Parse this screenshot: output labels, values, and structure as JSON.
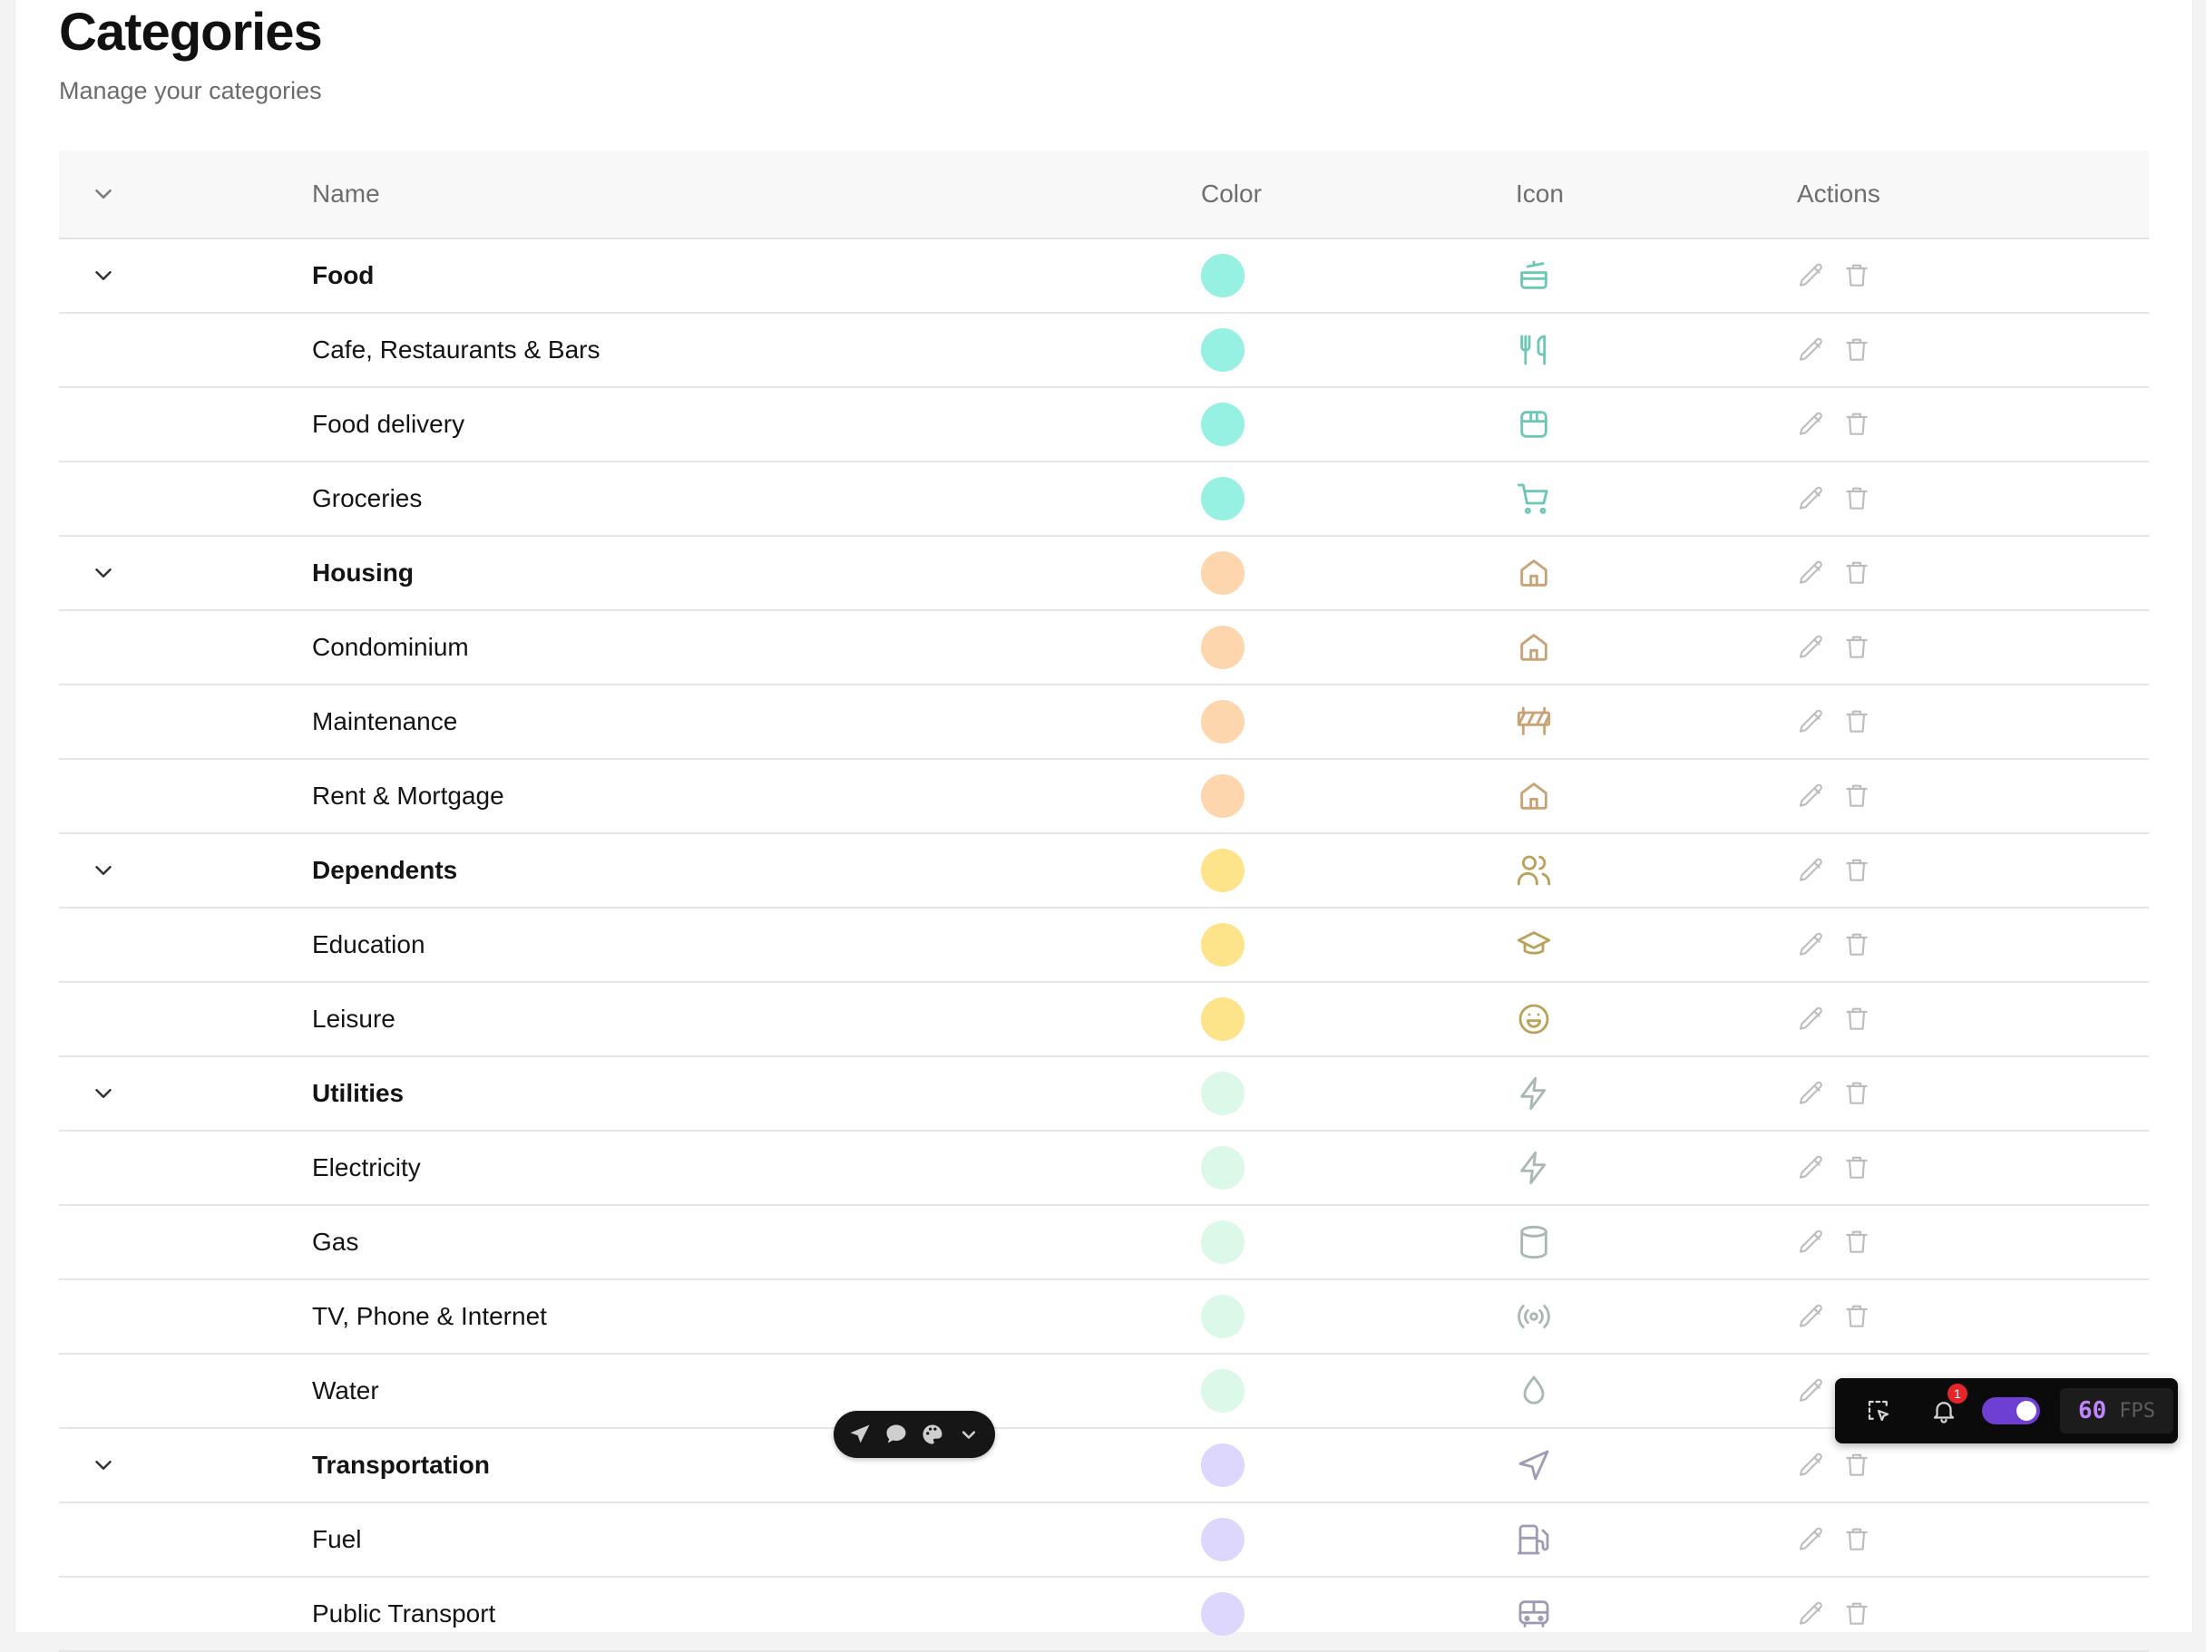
{
  "header": {
    "title": "Categories",
    "subtitle": "Manage your categories"
  },
  "table": {
    "columns": {
      "name": "Name",
      "color": "Color",
      "icon": "Icon",
      "actions": "Actions"
    },
    "rows": [
      {
        "name": "Food",
        "group": true,
        "color": "#97f1e3",
        "icon": "cooking-pot-icon",
        "icon_color": "#6ec7b6"
      },
      {
        "name": "Cafe, Restaurants & Bars",
        "group": false,
        "color": "#97f1e3",
        "icon": "utensils-icon",
        "icon_color": "#6ec7b6"
      },
      {
        "name": "Food delivery",
        "group": false,
        "color": "#97f1e3",
        "icon": "package-icon",
        "icon_color": "#6ec7b6"
      },
      {
        "name": "Groceries",
        "group": false,
        "color": "#97f1e3",
        "icon": "shopping-cart-icon",
        "icon_color": "#6ec7b6"
      },
      {
        "name": "Housing",
        "group": true,
        "color": "#fdd6ad",
        "icon": "house-icon",
        "icon_color": "#c9a275"
      },
      {
        "name": "Condominium",
        "group": false,
        "color": "#fdd6ad",
        "icon": "house-icon",
        "icon_color": "#c9a275"
      },
      {
        "name": "Maintenance",
        "group": false,
        "color": "#fdd6ad",
        "icon": "construction-barrier-icon",
        "icon_color": "#c9a275"
      },
      {
        "name": "Rent & Mortgage",
        "group": false,
        "color": "#fdd6ad",
        "icon": "house-icon",
        "icon_color": "#c9a275"
      },
      {
        "name": "Dependents",
        "group": true,
        "color": "#fde38a",
        "icon": "users-icon",
        "icon_color": "#bba25a"
      },
      {
        "name": "Education",
        "group": false,
        "color": "#fde38a",
        "icon": "graduation-cap-icon",
        "icon_color": "#bba25a"
      },
      {
        "name": "Leisure",
        "group": false,
        "color": "#fde38a",
        "icon": "smile-icon",
        "icon_color": "#bba25a"
      },
      {
        "name": "Utilities",
        "group": true,
        "color": "#dcf8e8",
        "icon": "zap-icon",
        "icon_color": "#a9b8b0"
      },
      {
        "name": "Electricity",
        "group": false,
        "color": "#dcf8e8",
        "icon": "zap-icon",
        "icon_color": "#a9b8b0"
      },
      {
        "name": "Gas",
        "group": false,
        "color": "#dcf8e8",
        "icon": "cylinder-icon",
        "icon_color": "#a9b8b0"
      },
      {
        "name": "TV, Phone & Internet",
        "group": false,
        "color": "#dcf8e8",
        "icon": "radio-icon",
        "icon_color": "#a9b8b0"
      },
      {
        "name": "Water",
        "group": false,
        "color": "#dcf8e8",
        "icon": "droplet-icon",
        "icon_color": "#a9b8b0"
      },
      {
        "name": "Transportation",
        "group": true,
        "color": "#ddd6fd",
        "icon": "navigation-icon",
        "icon_color": "#a19ab5"
      },
      {
        "name": "Fuel",
        "group": false,
        "color": "#ddd6fd",
        "icon": "fuel-icon",
        "icon_color": "#a19ab5"
      },
      {
        "name": "Public Transport",
        "group": false,
        "color": "#ddd6fd",
        "icon": "bus-icon",
        "icon_color": "#a19ab5"
      }
    ]
  },
  "colors": {
    "action_icon": "#bdbdbd",
    "chevron": "#333333"
  },
  "dev_toolbar": {
    "notification_count": "1",
    "fps_value": "60",
    "fps_label": "FPS"
  }
}
